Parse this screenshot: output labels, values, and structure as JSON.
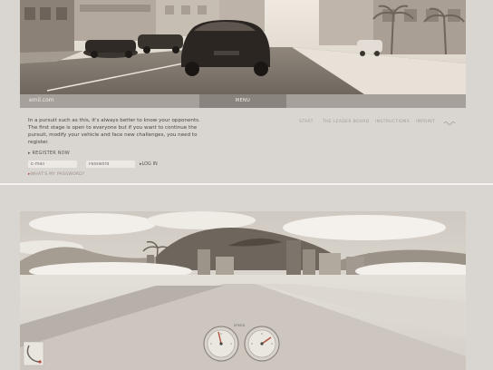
{
  "site": {
    "url": "emil.com",
    "menu_label": "MENU"
  },
  "intro": {
    "text": "In a pursuit such as this, it's always better to know your opponents. The first stage is open to everyone but if you want to continue the pursuit, modify your vehicle and face new challenges, you need to register."
  },
  "auth": {
    "register_label": "REGISTER NOW",
    "email_placeholder": "E-mail",
    "password_placeholder": "Password",
    "login_label": "LOG IN",
    "forgot_label": "WHAT'S MY PASSWORD?"
  },
  "nav": {
    "items": [
      {
        "label": "START"
      },
      {
        "label": "THE LEADER BOARD"
      },
      {
        "label": "INSTRUCTIONS"
      },
      {
        "label": "IMPRINT"
      }
    ]
  },
  "hud": {
    "speed_label": "SPEED"
  },
  "colors": {
    "page_bg": "#d9d5d0",
    "menu_strip": "#a6a09a",
    "menu_tab": "#8a847e",
    "accent_red": "#b05040"
  },
  "icons": {
    "minimap": "track-minimap-icon",
    "speedometer": "speedometer-gauge",
    "tachometer": "tachometer-gauge"
  }
}
